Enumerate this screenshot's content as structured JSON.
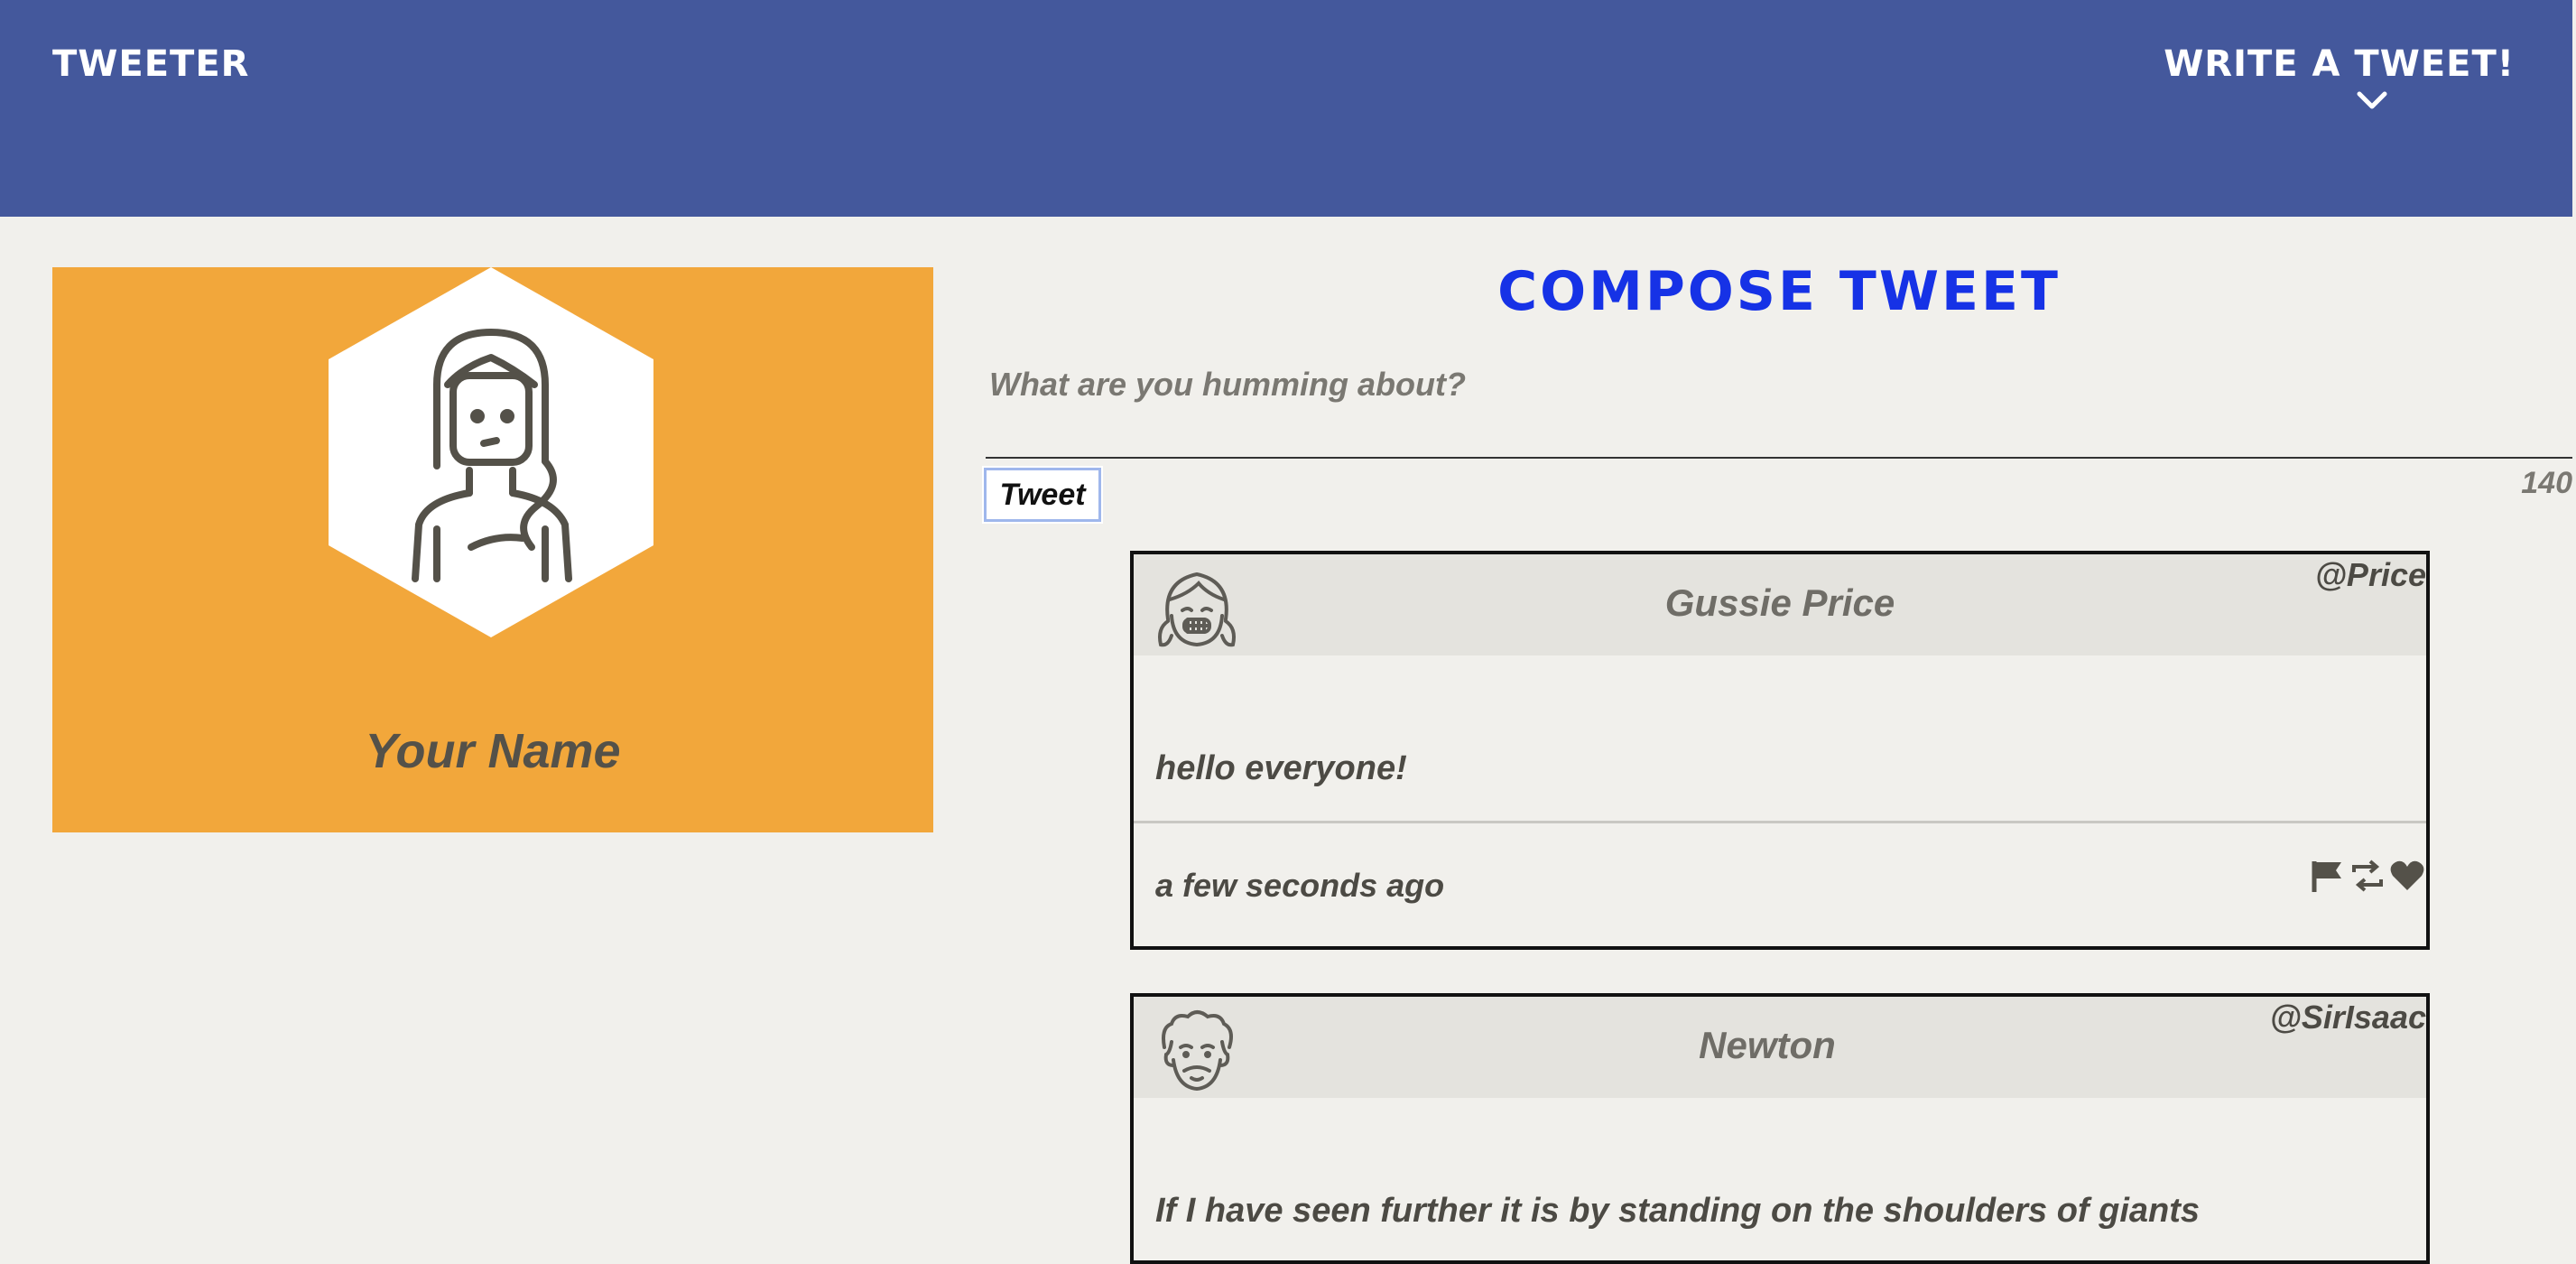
{
  "header": {
    "brand": "TWEETER",
    "write_button": "WRITE A TWEET!",
    "icons": {
      "chevron": "chevron-down-icon"
    },
    "colors": {
      "background": "#44589c",
      "text": "#ffffff"
    }
  },
  "profile": {
    "name": "Your Name",
    "colors": {
      "background": "#f2a73b"
    },
    "avatar_icon": "woman-avatar-icon"
  },
  "compose": {
    "title": "COMPOSE TWEET",
    "placeholder": "What are you humming about?",
    "button_label": "Tweet",
    "counter": "140",
    "colors": {
      "title": "#1632e6"
    }
  },
  "tweets": [
    {
      "name": "Gussie Price",
      "handle": "@Price",
      "text": "hello everyone!",
      "time": "a few seconds ago",
      "avatar_icon": "girl-avatar-icon",
      "actions": [
        "flag-icon",
        "retweet-icon",
        "heart-icon"
      ]
    },
    {
      "name": "Newton",
      "handle": "@SirIsaac",
      "text": "If I have seen further it is by standing on the shoulders of giants",
      "avatar_icon": "man-avatar-icon"
    }
  ]
}
